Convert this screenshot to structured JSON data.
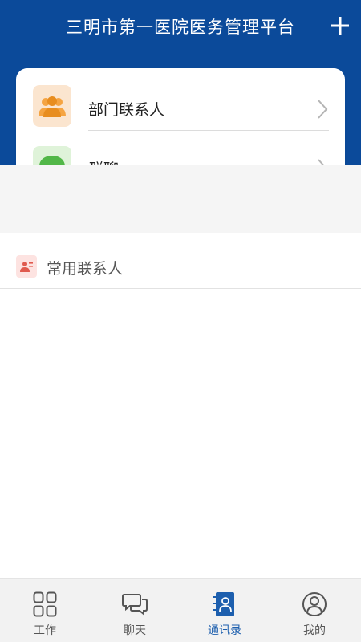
{
  "header": {
    "title": "三明市第一医院医务管理平台",
    "add_icon": "plus-icon",
    "color": "#0b4a9a"
  },
  "card": {
    "items": [
      {
        "label": "部门联系人",
        "icon": "department-contacts-icon",
        "icon_color": "#f0a23a"
      },
      {
        "label": "群聊",
        "icon": "group-chat-icon",
        "icon_color": "#5cc15a"
      }
    ]
  },
  "frequent": {
    "label": "常用联系人",
    "icon": "contact-card-icon",
    "icon_color": "#e05a4e"
  },
  "tabbar": {
    "active_color": "#1d5fae",
    "tabs": [
      {
        "label": "工作",
        "icon": "grid-icon",
        "active": false
      },
      {
        "label": "聊天",
        "icon": "chat-bubbles-icon",
        "active": false
      },
      {
        "label": "通讯录",
        "icon": "address-book-icon",
        "active": true
      },
      {
        "label": "我的",
        "icon": "user-profile-icon",
        "active": false
      }
    ]
  }
}
